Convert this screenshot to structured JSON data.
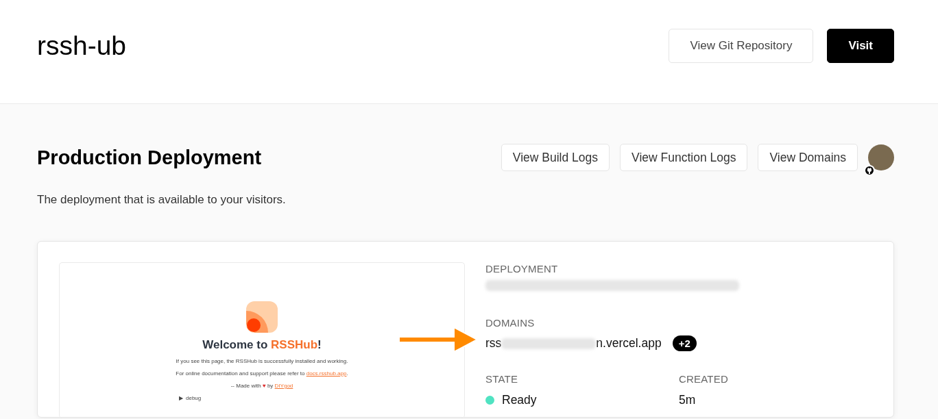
{
  "header": {
    "title": "rssh-ub",
    "buttons": [
      {
        "label": "View Git Repository",
        "kind": "secondary"
      },
      {
        "label": "Visit",
        "kind": "primary"
      }
    ]
  },
  "section": {
    "title": "Production Deployment",
    "description": "The deployment that is available to your visitors.",
    "buttons": [
      "View Build Logs",
      "View Function Logs",
      "View Domains"
    ]
  },
  "preview": {
    "heading": "Welcome to **RSSHub**!",
    "lines": [
      "If you see this page, the RSSHub is successfully installed and working."
    ],
    "docs_prefix": "For online documentation and support please refer to ",
    "docs_link": "docs.rsshub.app",
    "docs_suffix": ".",
    "made_prefix": "-- Made with",
    "heart": "♥",
    "made_by": "by",
    "author_link": "DIYgod",
    "debug_marker": "▶",
    "debug_label": "debug"
  },
  "details": {
    "deployment_label": "DEPLOYMENT",
    "domains_label": "DOMAINS",
    "domain_start": "rss",
    "domain_end": "n.vercel.app",
    "domain_extra": "+2",
    "state_label": "STATE",
    "state": {
      "text": "Ready",
      "color": "#50e3c2"
    },
    "created_label": "CREATED",
    "created": "5m"
  }
}
